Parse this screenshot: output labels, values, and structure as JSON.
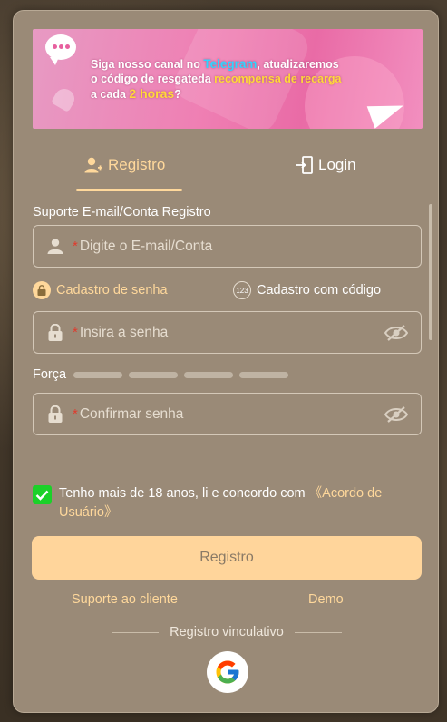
{
  "banner": {
    "line1_pre": "Siga nosso canal no ",
    "line1_tg": "Telegram",
    "line1_post": ", atualizaremos",
    "line2_pre": "o código de resgateda ",
    "line2_gold": "recompensa de recarga",
    "line3_pre": "a cada ",
    "line3_big": "2 horas",
    "line3_post": "?"
  },
  "tabs": {
    "register": "Registro",
    "login": "Login"
  },
  "form": {
    "account_label": "Suporte E-mail/Conta Registro",
    "required_mark": "*",
    "account_placeholder": "Digite o E-mail/Conta",
    "option_password": "Cadastro de senha",
    "option_code": "Cadastro com código",
    "option_code_badge": "123",
    "password_placeholder": "Insira a senha",
    "strength_label": "Força",
    "confirm_placeholder": "Confirmar senha"
  },
  "agreement": {
    "checked": true,
    "text": "Tenho mais de 18 anos, li e concordo com ",
    "link": "《Acordo de Usuário》"
  },
  "actions": {
    "submit": "Registro",
    "support": "Suporte ao cliente",
    "demo": "Demo",
    "divider": "Registro vinculativo"
  },
  "colors": {
    "accent": "#ffd89b",
    "panel": "#9a8a77",
    "check": "#1bd129",
    "required": "#e03a2d"
  }
}
